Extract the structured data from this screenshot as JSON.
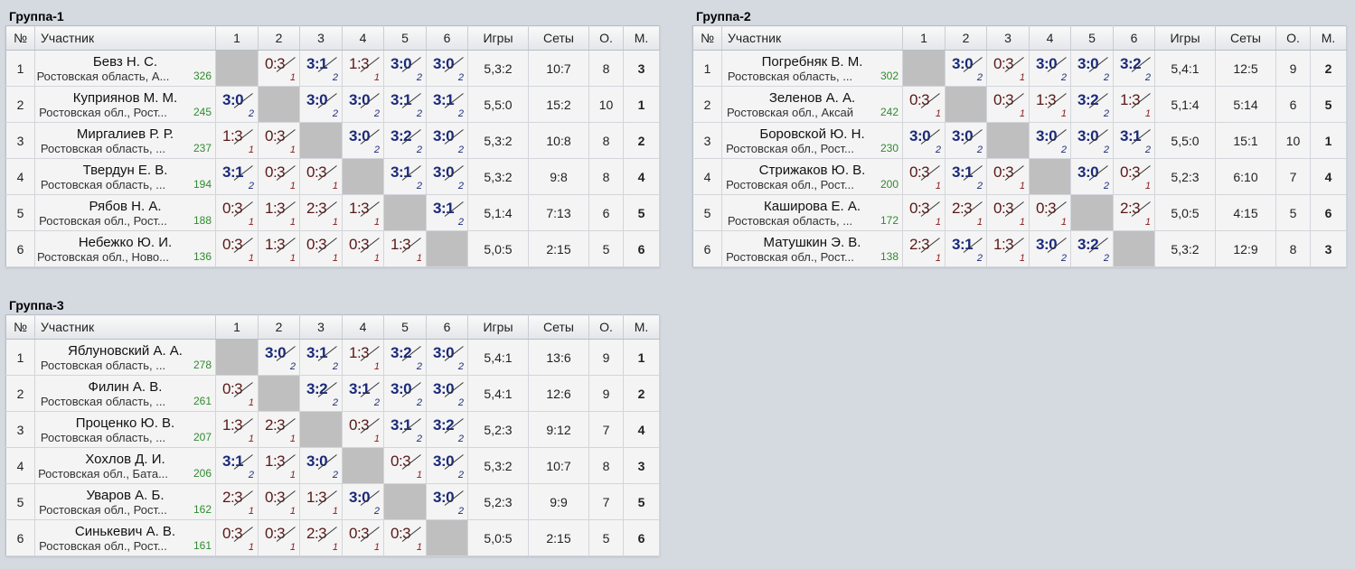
{
  "headers": {
    "num": "№",
    "player": "Участник",
    "cols": [
      "1",
      "2",
      "3",
      "4",
      "5",
      "6"
    ],
    "games": "Игры",
    "sets": "Сеты",
    "points": "О.",
    "place": "М."
  },
  "groups": [
    {
      "title": "Группа-1",
      "rows": [
        {
          "num": "1",
          "name": "Бевз Н. С.",
          "region": "Ростовская область, А...",
          "rating": "326",
          "scores": [
            null,
            {
              "s": "0:3",
              "p": "1",
              "w": false
            },
            {
              "s": "3:1",
              "p": "2",
              "w": true
            },
            {
              "s": "1:3",
              "p": "1",
              "w": false
            },
            {
              "s": "3:0",
              "p": "2",
              "w": true
            },
            {
              "s": "3:0",
              "p": "2",
              "w": true
            }
          ],
          "games": "5,3:2",
          "sets": "10:7",
          "points": "8",
          "place": "3"
        },
        {
          "num": "2",
          "name": "Куприянов М. М.",
          "region": "Ростовская обл., Рост...",
          "rating": "245",
          "scores": [
            {
              "s": "3:0",
              "p": "2",
              "w": true
            },
            null,
            {
              "s": "3:0",
              "p": "2",
              "w": true
            },
            {
              "s": "3:0",
              "p": "2",
              "w": true
            },
            {
              "s": "3:1",
              "p": "2",
              "w": true
            },
            {
              "s": "3:1",
              "p": "2",
              "w": true
            }
          ],
          "games": "5,5:0",
          "sets": "15:2",
          "points": "10",
          "place": "1"
        },
        {
          "num": "3",
          "name": "Миргалиев Р. Р.",
          "region": "Ростовская область, ...",
          "rating": "237",
          "scores": [
            {
              "s": "1:3",
              "p": "1",
              "w": false
            },
            {
              "s": "0:3",
              "p": "1",
              "w": false
            },
            null,
            {
              "s": "3:0",
              "p": "2",
              "w": true
            },
            {
              "s": "3:2",
              "p": "2",
              "w": true
            },
            {
              "s": "3:0",
              "p": "2",
              "w": true
            }
          ],
          "games": "5,3:2",
          "sets": "10:8",
          "points": "8",
          "place": "2"
        },
        {
          "num": "4",
          "name": "Твердун Е. В.",
          "region": "Ростовская область, ...",
          "rating": "194",
          "scores": [
            {
              "s": "3:1",
              "p": "2",
              "w": true
            },
            {
              "s": "0:3",
              "p": "1",
              "w": false
            },
            {
              "s": "0:3",
              "p": "1",
              "w": false
            },
            null,
            {
              "s": "3:1",
              "p": "2",
              "w": true
            },
            {
              "s": "3:0",
              "p": "2",
              "w": true
            }
          ],
          "games": "5,3:2",
          "sets": "9:8",
          "points": "8",
          "place": "4"
        },
        {
          "num": "5",
          "name": "Рябов Н. А.",
          "region": "Ростовская обл., Рост...",
          "rating": "188",
          "scores": [
            {
              "s": "0:3",
              "p": "1",
              "w": false
            },
            {
              "s": "1:3",
              "p": "1",
              "w": false
            },
            {
              "s": "2:3",
              "p": "1",
              "w": false
            },
            {
              "s": "1:3",
              "p": "1",
              "w": false
            },
            null,
            {
              "s": "3:1",
              "p": "2",
              "w": true
            }
          ],
          "games": "5,1:4",
          "sets": "7:13",
          "points": "6",
          "place": "5"
        },
        {
          "num": "6",
          "name": "Небежко Ю. И.",
          "region": "Ростовская обл., Ново...",
          "rating": "136",
          "scores": [
            {
              "s": "0:3",
              "p": "1",
              "w": false
            },
            {
              "s": "1:3",
              "p": "1",
              "w": false
            },
            {
              "s": "0:3",
              "p": "1",
              "w": false
            },
            {
              "s": "0:3",
              "p": "1",
              "w": false
            },
            {
              "s": "1:3",
              "p": "1",
              "w": false
            },
            null
          ],
          "games": "5,0:5",
          "sets": "2:15",
          "points": "5",
          "place": "6"
        }
      ]
    },
    {
      "title": "Группа-2",
      "rows": [
        {
          "num": "1",
          "name": "Погребняк В. М.",
          "region": "Ростовская область, ...",
          "rating": "302",
          "scores": [
            null,
            {
              "s": "3:0",
              "p": "2",
              "w": true
            },
            {
              "s": "0:3",
              "p": "1",
              "w": false
            },
            {
              "s": "3:0",
              "p": "2",
              "w": true
            },
            {
              "s": "3:0",
              "p": "2",
              "w": true
            },
            {
              "s": "3:2",
              "p": "2",
              "w": true
            }
          ],
          "games": "5,4:1",
          "sets": "12:5",
          "points": "9",
          "place": "2"
        },
        {
          "num": "2",
          "name": "Зеленов А. А.",
          "region": "Ростовская обл., Аксай",
          "rating": "242",
          "scores": [
            {
              "s": "0:3",
              "p": "1",
              "w": false
            },
            null,
            {
              "s": "0:3",
              "p": "1",
              "w": false
            },
            {
              "s": "1:3",
              "p": "1",
              "w": false
            },
            {
              "s": "3:2",
              "p": "2",
              "w": true
            },
            {
              "s": "1:3",
              "p": "1",
              "w": false
            }
          ],
          "games": "5,1:4",
          "sets": "5:14",
          "points": "6",
          "place": "5"
        },
        {
          "num": "3",
          "name": "Боровской Ю. Н.",
          "region": "Ростовская обл., Рост...",
          "rating": "230",
          "scores": [
            {
              "s": "3:0",
              "p": "2",
              "w": true
            },
            {
              "s": "3:0",
              "p": "2",
              "w": true
            },
            null,
            {
              "s": "3:0",
              "p": "2",
              "w": true
            },
            {
              "s": "3:0",
              "p": "2",
              "w": true
            },
            {
              "s": "3:1",
              "p": "2",
              "w": true
            }
          ],
          "games": "5,5:0",
          "sets": "15:1",
          "points": "10",
          "place": "1"
        },
        {
          "num": "4",
          "name": "Стрижаков Ю. В.",
          "region": "Ростовская обл., Рост...",
          "rating": "200",
          "scores": [
            {
              "s": "0:3",
              "p": "1",
              "w": false
            },
            {
              "s": "3:1",
              "p": "2",
              "w": true
            },
            {
              "s": "0:3",
              "p": "1",
              "w": false
            },
            null,
            {
              "s": "3:0",
              "p": "2",
              "w": true
            },
            {
              "s": "0:3",
              "p": "1",
              "w": false
            }
          ],
          "games": "5,2:3",
          "sets": "6:10",
          "points": "7",
          "place": "4"
        },
        {
          "num": "5",
          "name": "Каширова Е. А.",
          "region": "Ростовская область, ...",
          "rating": "172",
          "scores": [
            {
              "s": "0:3",
              "p": "1",
              "w": false
            },
            {
              "s": "2:3",
              "p": "1",
              "w": false
            },
            {
              "s": "0:3",
              "p": "1",
              "w": false
            },
            {
              "s": "0:3",
              "p": "1",
              "w": false
            },
            null,
            {
              "s": "2:3",
              "p": "1",
              "w": false
            }
          ],
          "games": "5,0:5",
          "sets": "4:15",
          "points": "5",
          "place": "6"
        },
        {
          "num": "6",
          "name": "Матушкин Э. В.",
          "region": "Ростовская обл., Рост...",
          "rating": "138",
          "scores": [
            {
              "s": "2:3",
              "p": "1",
              "w": false
            },
            {
              "s": "3:1",
              "p": "2",
              "w": true
            },
            {
              "s": "1:3",
              "p": "1",
              "w": false
            },
            {
              "s": "3:0",
              "p": "2",
              "w": true
            },
            {
              "s": "3:2",
              "p": "2",
              "w": true
            },
            null
          ],
          "games": "5,3:2",
          "sets": "12:9",
          "points": "8",
          "place": "3"
        }
      ]
    },
    {
      "title": "Группа-3",
      "rows": [
        {
          "num": "1",
          "name": "Яблуновский А. А.",
          "region": "Ростовская область, ...",
          "rating": "278",
          "scores": [
            null,
            {
              "s": "3:0",
              "p": "2",
              "w": true
            },
            {
              "s": "3:1",
              "p": "2",
              "w": true
            },
            {
              "s": "1:3",
              "p": "1",
              "w": false
            },
            {
              "s": "3:2",
              "p": "2",
              "w": true
            },
            {
              "s": "3:0",
              "p": "2",
              "w": true
            }
          ],
          "games": "5,4:1",
          "sets": "13:6",
          "points": "9",
          "place": "1"
        },
        {
          "num": "2",
          "name": "Филин А. В.",
          "region": "Ростовская область, ...",
          "rating": "261",
          "scores": [
            {
              "s": "0:3",
              "p": "1",
              "w": false
            },
            null,
            {
              "s": "3:2",
              "p": "2",
              "w": true
            },
            {
              "s": "3:1",
              "p": "2",
              "w": true
            },
            {
              "s": "3:0",
              "p": "2",
              "w": true
            },
            {
              "s": "3:0",
              "p": "2",
              "w": true
            }
          ],
          "games": "5,4:1",
          "sets": "12:6",
          "points": "9",
          "place": "2"
        },
        {
          "num": "3",
          "name": "Проценко Ю. В.",
          "region": "Ростовская область, ...",
          "rating": "207",
          "scores": [
            {
              "s": "1:3",
              "p": "1",
              "w": false
            },
            {
              "s": "2:3",
              "p": "1",
              "w": false
            },
            null,
            {
              "s": "0:3",
              "p": "1",
              "w": false
            },
            {
              "s": "3:1",
              "p": "2",
              "w": true
            },
            {
              "s": "3:2",
              "p": "2",
              "w": true
            }
          ],
          "games": "5,2:3",
          "sets": "9:12",
          "points": "7",
          "place": "4"
        },
        {
          "num": "4",
          "name": "Хохлов Д. И.",
          "region": "Ростовская обл., Бата...",
          "rating": "206",
          "scores": [
            {
              "s": "3:1",
              "p": "2",
              "w": true
            },
            {
              "s": "1:3",
              "p": "1",
              "w": false
            },
            {
              "s": "3:0",
              "p": "2",
              "w": true
            },
            null,
            {
              "s": "0:3",
              "p": "1",
              "w": false
            },
            {
              "s": "3:0",
              "p": "2",
              "w": true
            }
          ],
          "games": "5,3:2",
          "sets": "10:7",
          "points": "8",
          "place": "3"
        },
        {
          "num": "5",
          "name": "Уваров А. Б.",
          "region": "Ростовская обл., Рост...",
          "rating": "162",
          "scores": [
            {
              "s": "2:3",
              "p": "1",
              "w": false
            },
            {
              "s": "0:3",
              "p": "1",
              "w": false
            },
            {
              "s": "1:3",
              "p": "1",
              "w": false
            },
            {
              "s": "3:0",
              "p": "2",
              "w": true
            },
            null,
            {
              "s": "3:0",
              "p": "2",
              "w": true
            }
          ],
          "games": "5,2:3",
          "sets": "9:9",
          "points": "7",
          "place": "5"
        },
        {
          "num": "6",
          "name": "Синькевич А. В.",
          "region": "Ростовская обл., Рост...",
          "rating": "161",
          "scores": [
            {
              "s": "0:3",
              "p": "1",
              "w": false
            },
            {
              "s": "0:3",
              "p": "1",
              "w": false
            },
            {
              "s": "2:3",
              "p": "1",
              "w": false
            },
            {
              "s": "0:3",
              "p": "1",
              "w": false
            },
            {
              "s": "0:3",
              "p": "1",
              "w": false
            },
            null
          ],
          "games": "5,0:5",
          "sets": "2:15",
          "points": "5",
          "place": "6"
        }
      ]
    }
  ]
}
